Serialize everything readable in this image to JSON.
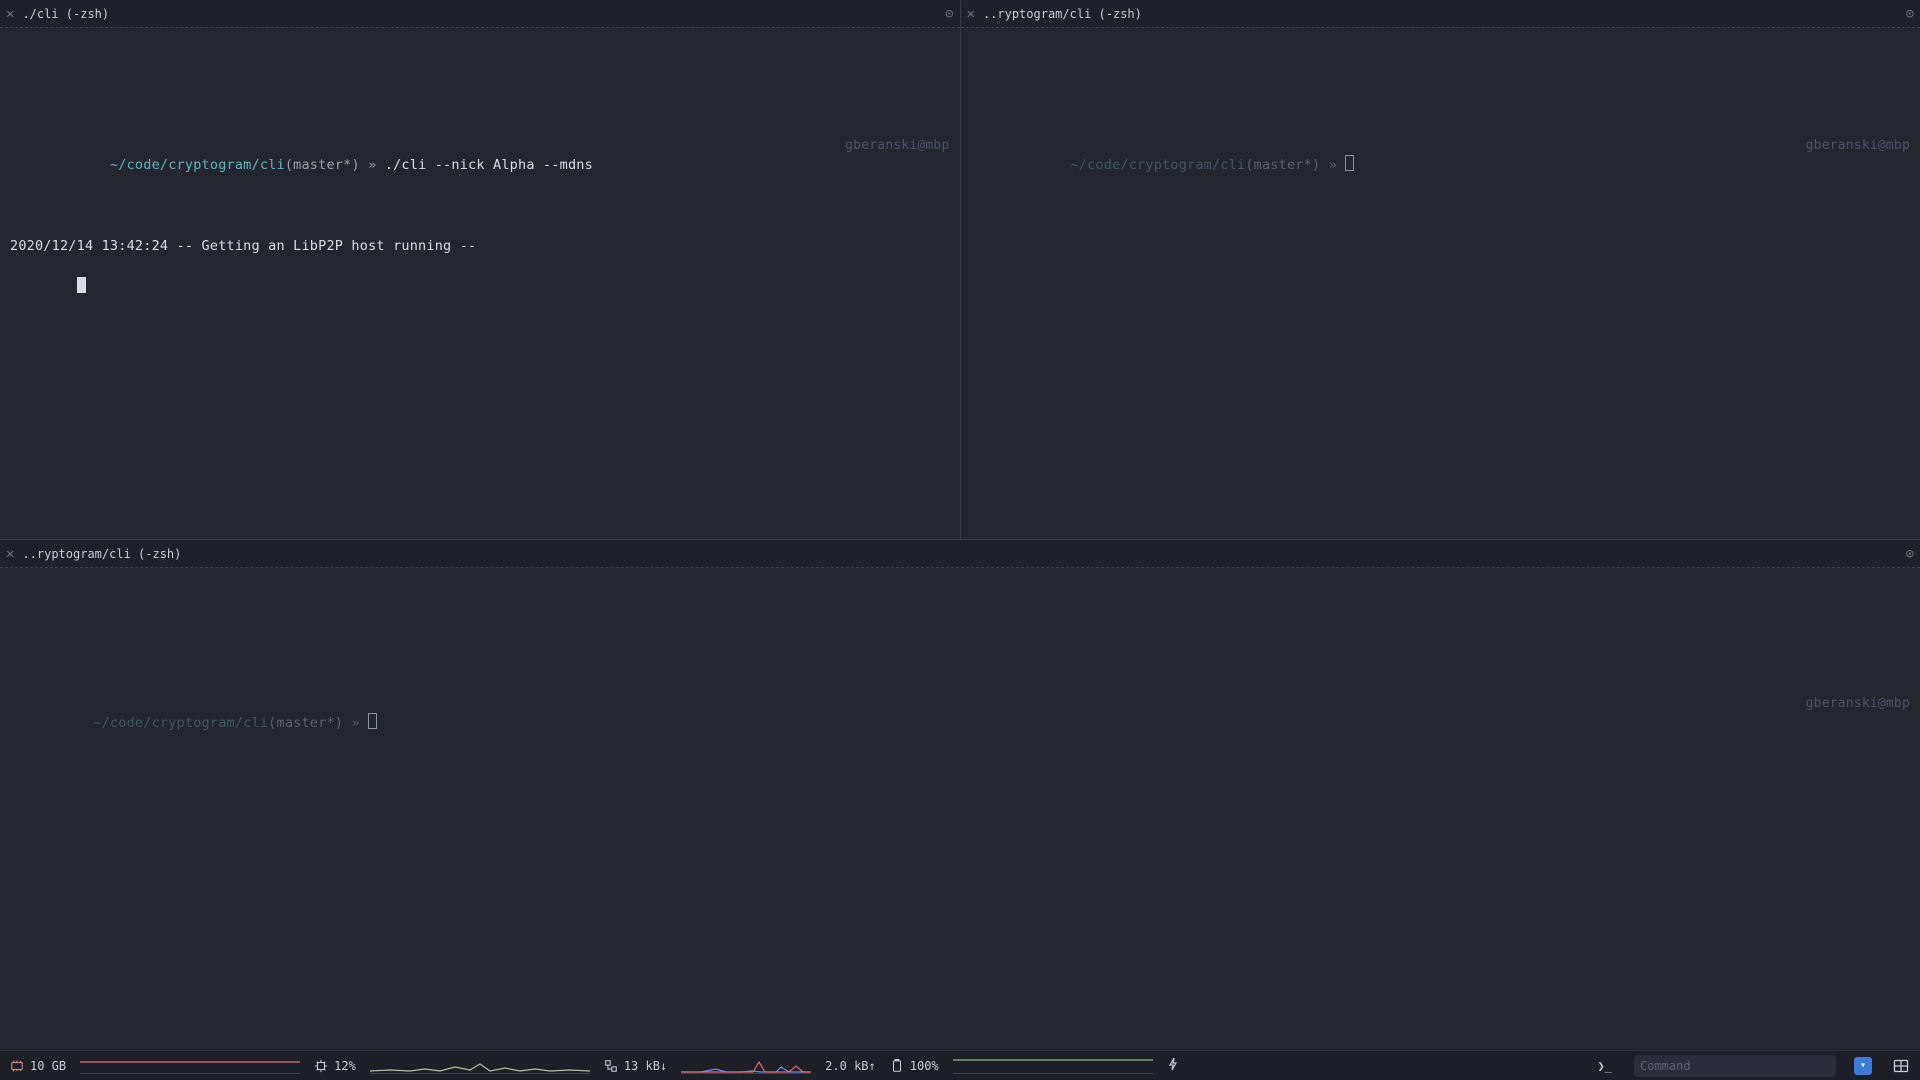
{
  "panes": {
    "top_left": {
      "title": "./cli (-zsh)",
      "prompt": {
        "path": "~/code/cryptogram/cli",
        "branch": "master*",
        "symbol": "»",
        "command": "./cli --nick Alpha --mdns",
        "userhost": "gberanski@mbp"
      },
      "output": "2020/12/14 13:42:24 -- Getting an LibP2P host running --"
    },
    "top_right": {
      "title": "..ryptogram/cli (-zsh)",
      "prompt": {
        "path": "~/code/cryptogram/cli",
        "branch": "master*",
        "symbol": "»",
        "userhost": "gberanski@mbp"
      }
    },
    "bottom": {
      "title": "..ryptogram/cli (-zsh)",
      "prompt": {
        "path": "~/code/cryptogram/cli",
        "branch": "master*",
        "symbol": "»",
        "userhost": "gberanski@mbp"
      }
    }
  },
  "status": {
    "memory": {
      "value": "10 GB"
    },
    "cpu": {
      "value": "12%"
    },
    "net_down": {
      "value": "13 kB↓"
    },
    "net_up": {
      "value": "2.0 kB↑"
    },
    "battery": {
      "value": "100%"
    },
    "command_placeholder": "Command"
  },
  "icons": {
    "close": "✕",
    "more": "⊙",
    "lightning": "⚡",
    "prompt": "❯_",
    "dropdown": "▾"
  }
}
